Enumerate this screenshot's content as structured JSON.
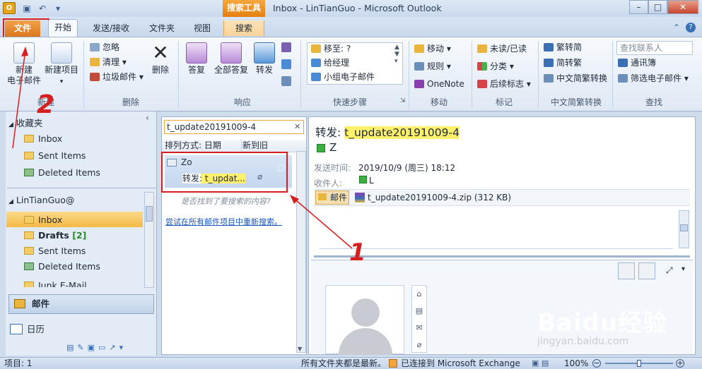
{
  "titlebar": {
    "context_tab": "搜索工具",
    "title": "Inbox - LinTianGuo - Microsoft Outlook",
    "minimize": "–",
    "maximize": "□",
    "close": "✕"
  },
  "tabs": [
    "文件",
    "开始",
    "发送/接收",
    "文件夹",
    "视图",
    "搜索"
  ],
  "ribbon": {
    "new": {
      "new_email": "新建\n电子邮件",
      "new_items": "新建项目",
      "label": "新建"
    },
    "delete": {
      "ignore": "忽略",
      "cleanup": "清理",
      "junk": "垃圾邮件",
      "delete": "删除",
      "label": "删除"
    },
    "respond": {
      "reply": "答复",
      "reply_all": "全部答复",
      "forward": "转发",
      "label": "响应"
    },
    "quicksteps": {
      "items": [
        "移至: ?",
        "给经理",
        "小组电子邮件"
      ],
      "label": "快速步骤"
    },
    "move": {
      "move": "移动",
      "rules": "规则",
      "onenote": "OneNote",
      "label": "移动"
    },
    "tags": {
      "unread": "未读/已读",
      "categorize": "分类",
      "followup": "后续标志",
      "label": "标记"
    },
    "chinese": {
      "trad": "繁转简",
      "simp": "简转繁",
      "convert": "中文简繁转换",
      "label": "中文简繁转换"
    },
    "find": {
      "find_contact": "查找联系人",
      "address_book": "通讯簿",
      "filter": "筛选电子邮件",
      "label": "查找"
    }
  },
  "nav": {
    "favorites_header": "收藏夹",
    "favorites": [
      "Inbox",
      "Sent Items",
      "Deleted Items"
    ],
    "account": "LinTianGuo@",
    "folders": [
      {
        "name": "Inbox",
        "count": ""
      },
      {
        "name": "Drafts",
        "count": "[2]"
      },
      {
        "name": "Sent Items",
        "count": ""
      },
      {
        "name": "Deleted Items",
        "count": ""
      },
      {
        "name": "Junk E-Mail",
        "count": ""
      }
    ],
    "mail": "邮件",
    "calendar": "日历"
  },
  "list": {
    "search_value": "t_update20191009-4",
    "sort_by": "排列方式: 日期",
    "sort_order": "新到旧",
    "item_sender": "Zo",
    "item_subject": "转发: t_updat...",
    "not_found": "是否找到了要搜索的内容?",
    "retry": "尝试在所有邮件项目中重新搜索。"
  },
  "reading": {
    "subject_prefix": "转发: ",
    "subject_text": "t_update20191009-4",
    "sender": "Z",
    "sent_label": "发送时间:",
    "sent_value": "2019/10/9 (周三) 18:12",
    "to_label": "收件人:",
    "to_value": "L",
    "mail_tab": "邮件",
    "attachment": "t_update20191009-4.zip (312 KB)"
  },
  "status": {
    "items": "项目: 1",
    "uptodate": "所有文件夹都是最新。",
    "connected": "已连接到 Microsoft Exchange",
    "zoom": "100%"
  },
  "annotations": {
    "one": "1",
    "two": "2"
  },
  "watermark": {
    "main": "Baidu经验",
    "sub": "jingyan.baidu.com"
  }
}
